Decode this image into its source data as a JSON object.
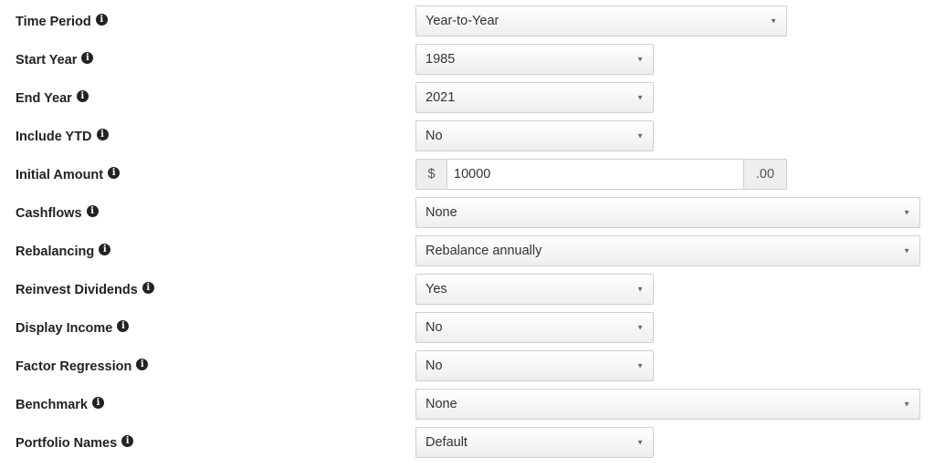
{
  "fields": {
    "time_period": {
      "label": "Time Period",
      "value": "Year-to-Year"
    },
    "start_year": {
      "label": "Start Year",
      "value": "1985"
    },
    "end_year": {
      "label": "End Year",
      "value": "2021"
    },
    "include_ytd": {
      "label": "Include YTD",
      "value": "No"
    },
    "initial_amount": {
      "label": "Initial Amount",
      "prefix": "$",
      "value": "10000",
      "suffix": ".00"
    },
    "cashflows": {
      "label": "Cashflows",
      "value": "None"
    },
    "rebalancing": {
      "label": "Rebalancing",
      "value": "Rebalance annually"
    },
    "reinvest_dividends": {
      "label": "Reinvest Dividends",
      "value": "Yes"
    },
    "display_income": {
      "label": "Display Income",
      "value": "No"
    },
    "factor_regression": {
      "label": "Factor Regression",
      "value": "No"
    },
    "benchmark": {
      "label": "Benchmark",
      "value": "None"
    },
    "portfolio_names": {
      "label": "Portfolio Names",
      "value": "Default"
    }
  },
  "icons": {
    "info": "info-circle-icon",
    "caret": "caret-down-icon"
  }
}
